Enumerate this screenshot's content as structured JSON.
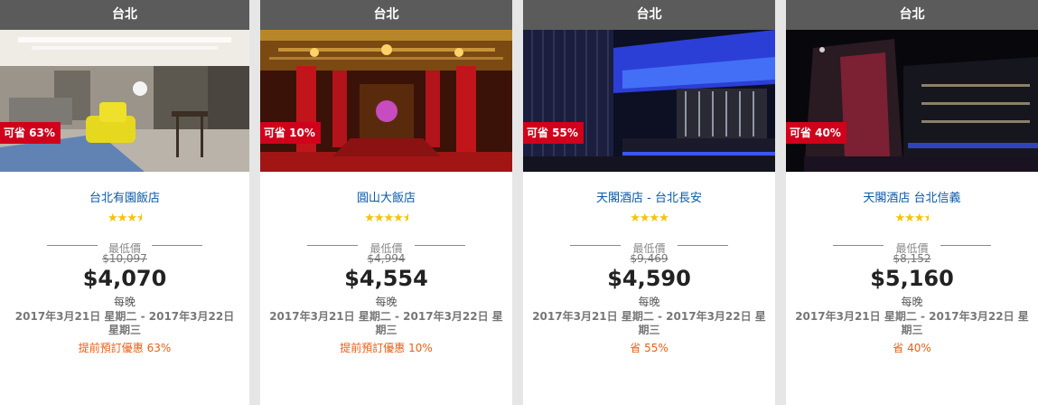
{
  "cards": [
    {
      "city": "台北",
      "badge": "可省 63%",
      "name": "台北有園飯店",
      "rating": 3.5,
      "stars": "★★★",
      "lowest_label": "最低價",
      "original_price": "$10,097",
      "price": "$4,070",
      "per_night": "每晚",
      "dates": "2017年3月21日 星期二 - 2017年3月22日 星期三",
      "promo": "提前預訂優惠 63%",
      "photo": "hotel-lobby-photo"
    },
    {
      "city": "台北",
      "badge": "可省 10%",
      "name": "圓山大飯店",
      "rating": 4.5,
      "stars": "★★★★",
      "lowest_label": "最低價",
      "original_price": "$4,994",
      "price": "$4,554",
      "per_night": "每晚",
      "dates": "2017年3月21日 星期二 - 2017年3月22日 星期三",
      "promo": "提前預訂優惠 10%",
      "photo": "grand-hall-photo"
    },
    {
      "city": "台北",
      "badge": "可省 55%",
      "name": "天閣酒店 - 台北長安",
      "rating": 4,
      "stars": "★★★★",
      "lowest_label": "最低價",
      "original_price": "$9,469",
      "price": "$4,590",
      "per_night": "每晚",
      "dates": "2017年3月21日 星期二 - 2017年3月22日 星期三",
      "promo": "省 55%",
      "photo": "reception-photo"
    },
    {
      "city": "台北",
      "badge": "可省 40%",
      "name": "天閣酒店 台北信義",
      "rating": 3.5,
      "stars": "★★★",
      "lowest_label": "最低價",
      "original_price": "$8,152",
      "price": "$5,160",
      "per_night": "每晚",
      "dates": "2017年3月21日 星期二 - 2017年3月22日 星期三",
      "promo": "省 40%",
      "photo": "building-night-photo"
    }
  ],
  "colors": {
    "header_bg": "#5b5b5b",
    "badge_bg": "#d0021b",
    "link": "#0a5aa8",
    "star": "#f5c400",
    "promo": "#e85f16"
  }
}
